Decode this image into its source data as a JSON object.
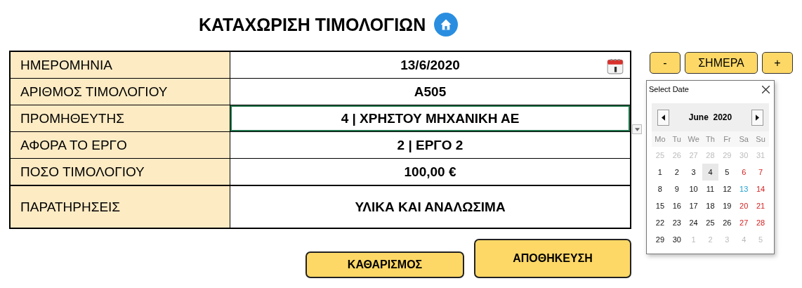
{
  "title": "ΚΑΤΑΧΩΡΙΣΗ ΤΙΜΟΛΟΓΙΩΝ",
  "form": {
    "rows": [
      {
        "label": "ΗΜΕΡΟΜΗΝΙΑ",
        "value": "13/6/2020",
        "kind": "date",
        "selected": false
      },
      {
        "label": "ΑΡΙΘΜΟΣ ΤΙΜΟΛΟΓΙΟΥ",
        "value": "Α505",
        "kind": "text",
        "selected": false
      },
      {
        "label": "ΠΡΟΜΗΘΕΥΤΗΣ",
        "value": "4 | ΧΡΗΣΤΟΥ ΜΗΧΑΝΙΚΗ ΑΕ",
        "kind": "dropdown",
        "selected": true
      },
      {
        "label": "ΑΦΟΡΑ ΤΟ ΕΡΓΟ",
        "value": "2 | ΕΡΓΟ 2",
        "kind": "text",
        "selected": false
      },
      {
        "label": "ΠΟΣΟ ΤΙΜΟΛΟΓΙΟΥ",
        "value": "100,00 €",
        "kind": "text",
        "selected": false
      },
      {
        "label": "ΠΑΡΑΤΗΡΗΣΕΙΣ",
        "value": "ΥΛΙΚΑ ΚΑΙ ΑΝΑΛΩΣΙΜΑ",
        "kind": "tall",
        "selected": false
      }
    ]
  },
  "date_buttons": [
    "-",
    "ΣΗΜΕΡΑ",
    "+"
  ],
  "date_picker": {
    "title": "Select Date",
    "month": "June  2020",
    "weekdays": [
      "Mo",
      "Tu",
      "We",
      "Th",
      "Fr",
      "Sa",
      "Su"
    ],
    "weeks": [
      [
        {
          "day": "25",
          "kind": "other",
          "selected": false
        },
        {
          "day": "26",
          "kind": "other",
          "selected": false
        },
        {
          "day": "27",
          "kind": "other",
          "selected": false
        },
        {
          "day": "28",
          "kind": "other",
          "selected": false
        },
        {
          "day": "29",
          "kind": "other",
          "selected": false
        },
        {
          "day": "30",
          "kind": "other",
          "selected": false
        },
        {
          "day": "31",
          "kind": "other",
          "selected": false
        }
      ],
      [
        {
          "day": "1",
          "kind": "weekday",
          "selected": false
        },
        {
          "day": "2",
          "kind": "weekday",
          "selected": false
        },
        {
          "day": "3",
          "kind": "weekday",
          "selected": false
        },
        {
          "day": "4",
          "kind": "weekday",
          "selected": true
        },
        {
          "day": "5",
          "kind": "weekday",
          "selected": false
        },
        {
          "day": "6",
          "kind": "weekend",
          "selected": false
        },
        {
          "day": "7",
          "kind": "weekend",
          "selected": false
        }
      ],
      [
        {
          "day": "8",
          "kind": "weekday",
          "selected": false
        },
        {
          "day": "9",
          "kind": "weekday",
          "selected": false
        },
        {
          "day": "10",
          "kind": "weekday",
          "selected": false
        },
        {
          "day": "11",
          "kind": "weekday",
          "selected": false
        },
        {
          "day": "12",
          "kind": "weekday",
          "selected": false
        },
        {
          "day": "13",
          "kind": "today",
          "selected": false
        },
        {
          "day": "14",
          "kind": "weekend",
          "selected": false
        }
      ],
      [
        {
          "day": "15",
          "kind": "weekday",
          "selected": false
        },
        {
          "day": "16",
          "kind": "weekday",
          "selected": false
        },
        {
          "day": "17",
          "kind": "weekday",
          "selected": false
        },
        {
          "day": "18",
          "kind": "weekday",
          "selected": false
        },
        {
          "day": "19",
          "kind": "weekday",
          "selected": false
        },
        {
          "day": "20",
          "kind": "weekend",
          "selected": false
        },
        {
          "day": "21",
          "kind": "weekend",
          "selected": false
        }
      ],
      [
        {
          "day": "22",
          "kind": "weekday",
          "selected": false
        },
        {
          "day": "23",
          "kind": "weekday",
          "selected": false
        },
        {
          "day": "24",
          "kind": "weekday",
          "selected": false
        },
        {
          "day": "25",
          "kind": "weekday",
          "selected": false
        },
        {
          "day": "26",
          "kind": "weekday",
          "selected": false
        },
        {
          "day": "27",
          "kind": "weekend",
          "selected": false
        },
        {
          "day": "28",
          "kind": "weekend",
          "selected": false
        }
      ],
      [
        {
          "day": "29",
          "kind": "weekday",
          "selected": false
        },
        {
          "day": "30",
          "kind": "weekday",
          "selected": false
        },
        {
          "day": "1",
          "kind": "other",
          "selected": false
        },
        {
          "day": "2",
          "kind": "other",
          "selected": false
        },
        {
          "day": "3",
          "kind": "other",
          "selected": false
        },
        {
          "day": "4",
          "kind": "other",
          "selected": false
        },
        {
          "day": "5",
          "kind": "other",
          "selected": false
        }
      ]
    ]
  },
  "actions": [
    "ΚΑΘΑΡΙΣΜΟΣ",
    "ΑΠΟΘΗΚΕΥΣΗ"
  ]
}
